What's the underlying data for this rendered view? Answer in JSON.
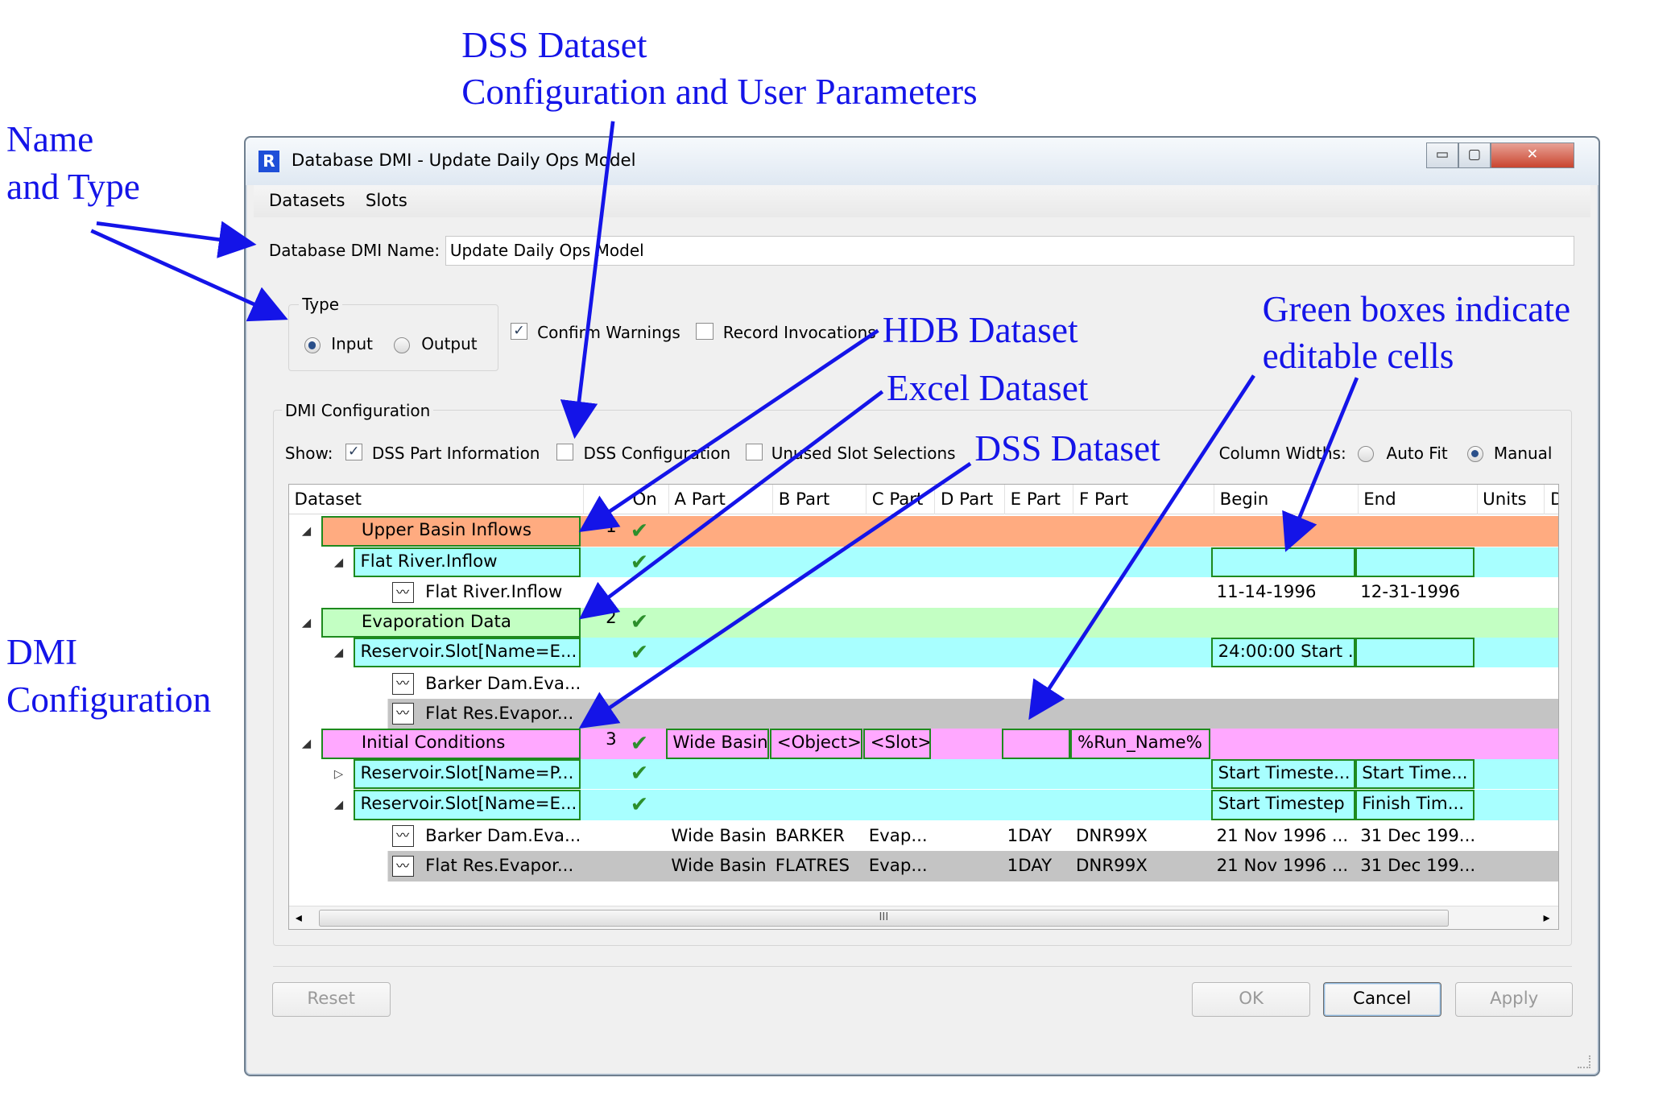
{
  "annotations": {
    "dss_top": [
      "DSS Dataset",
      "Configuration and User Parameters"
    ],
    "name_type": [
      "Name",
      "and Type"
    ],
    "hdb": "HDB Dataset",
    "excel": "Excel Dataset",
    "dss_mid": "DSS Dataset",
    "green": [
      "Green boxes indicate",
      "editable cells"
    ],
    "dmi": [
      "DMI",
      "Configuration"
    ]
  },
  "window": {
    "title": "Database DMI - Update Daily Ops Model",
    "menu": [
      "Datasets",
      "Slots"
    ],
    "name_label": "Database DMI Name:",
    "name_value": "Update Daily Ops Model",
    "type_label": "Type",
    "type_options": [
      "Input",
      "Output"
    ],
    "type_selected": "Input",
    "confirm_warnings": "Confirm Warnings",
    "confirm_warnings_checked": true,
    "record_invocations": "Record Invocations",
    "record_invocations_checked": false
  },
  "config": {
    "group_label": "DMI Configuration",
    "show_label": "Show:",
    "show_options": [
      {
        "label": "DSS Part Information",
        "checked": true
      },
      {
        "label": "DSS Configuration",
        "checked": false
      },
      {
        "label": "Unused Slot Selections",
        "checked": false
      }
    ],
    "column_widths_label": "Column Widths:",
    "width_options": [
      "Auto Fit",
      "Manual"
    ],
    "width_selected": "Manual"
  },
  "table": {
    "columns": [
      "Dataset",
      "On",
      "A Part",
      "B Part",
      "C Part",
      "D Part",
      "E Part",
      "F Part",
      "Begin",
      "End",
      "Units",
      "D"
    ],
    "rows": [
      {
        "level": 0,
        "name": "Upper Basin Inflows",
        "num": "1",
        "on": true,
        "bg": "#ffab80",
        "expanded": true
      },
      {
        "level": 1,
        "name": "Flat River.Inflow",
        "on": true,
        "bg": "#a8ffff",
        "expanded": true,
        "begin": "",
        "end": ""
      },
      {
        "level": 2,
        "name": "Flat River.Inflow",
        "bg": "#ffffff",
        "begin": "11-14-1996",
        "end": "12-31-1996"
      },
      {
        "level": 0,
        "name": "Evaporation Data",
        "num": "2",
        "on": true,
        "bg": "#c3ffc3",
        "expanded": true
      },
      {
        "level": 1,
        "name": "Reservoir.Slot[Name=E...",
        "on": true,
        "bg": "#a8ffff",
        "expanded": true,
        "begin": "24:00:00 Start ...",
        "end": ""
      },
      {
        "level": 2,
        "name": "Barker Dam.Eva...",
        "bg": "#ffffff"
      },
      {
        "level": 2,
        "name": "Flat Res.Evapor...",
        "bg": "#c4c4c4"
      },
      {
        "level": 0,
        "name": "Initial Conditions",
        "num": "3",
        "on": true,
        "bg": "#ffa8ff",
        "expanded": true,
        "a": "Wide Basin",
        "b": "<Object>",
        "c": "<Slot>",
        "e": "",
        "f": "%Run_Name%"
      },
      {
        "level": 1,
        "name": "Reservoir.Slot[Name=P...",
        "on": true,
        "bg": "#a8ffff",
        "expanded": false,
        "begin": "Start Timeste...",
        "end": "Start Time..."
      },
      {
        "level": 1,
        "name": "Reservoir.Slot[Name=E...",
        "on": true,
        "bg": "#a8ffff",
        "expanded": true,
        "begin": "Start Timestep",
        "end": "Finish Tim..."
      },
      {
        "level": 2,
        "name": "Barker Dam.Eva...",
        "bg": "#ffffff",
        "a": "Wide Basin",
        "b": "BARKER",
        "c": "Evap...",
        "e": "1DAY",
        "f": "DNR99X",
        "begin": "21 Nov 1996 ...",
        "end": "31 Dec 199..."
      },
      {
        "level": 2,
        "name": "Flat Res.Evapor...",
        "bg": "#c4c4c4",
        "a": "Wide Basin",
        "b": "FLATRES",
        "c": "Evap...",
        "e": "1DAY",
        "f": "DNR99X",
        "begin": "21 Nov 1996 ...",
        "end": "31 Dec 199..."
      }
    ],
    "scroll_grip": "III"
  },
  "buttons": {
    "reset": "Reset",
    "ok": "OK",
    "cancel": "Cancel",
    "apply": "Apply"
  },
  "titlebar_buttons": {
    "minimize": "▭",
    "maximize": "▢",
    "close": "✕"
  }
}
